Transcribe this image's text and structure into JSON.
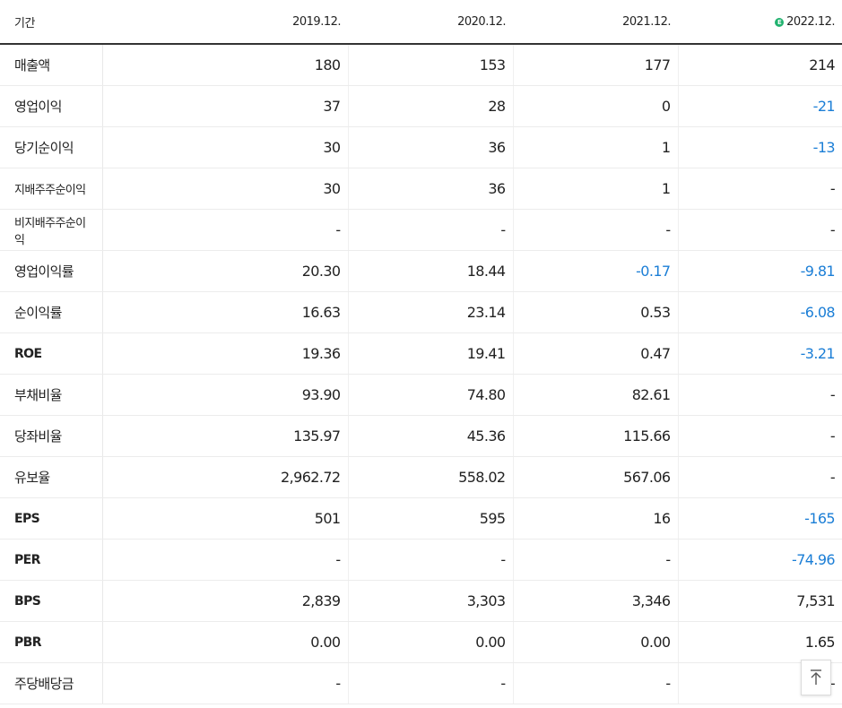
{
  "header": {
    "period_label": "기간",
    "years": [
      "2019.12.",
      "2020.12.",
      "2021.12.",
      "2022.12."
    ],
    "estimate_badge": "E"
  },
  "rows": [
    {
      "label": "매출액",
      "values": [
        "180",
        "153",
        "177",
        "214"
      ]
    },
    {
      "label": "영업이익",
      "values": [
        "37",
        "28",
        "0",
        "-21"
      ]
    },
    {
      "label": "당기순이익",
      "values": [
        "30",
        "36",
        "1",
        "-13"
      ]
    },
    {
      "label": "지배주주순이익",
      "values": [
        "30",
        "36",
        "1",
        "-"
      ]
    },
    {
      "label": "비지배주주순이익",
      "values": [
        "-",
        "-",
        "-",
        "-"
      ]
    },
    {
      "label": "영업이익률",
      "values": [
        "20.30",
        "18.44",
        "-0.17",
        "-9.81"
      ]
    },
    {
      "label": "순이익률",
      "values": [
        "16.63",
        "23.14",
        "0.53",
        "-6.08"
      ]
    },
    {
      "label": "ROE",
      "values": [
        "19.36",
        "19.41",
        "0.47",
        "-3.21"
      ]
    },
    {
      "label": "부채비율",
      "values": [
        "93.90",
        "74.80",
        "82.61",
        "-"
      ]
    },
    {
      "label": "당좌비율",
      "values": [
        "135.97",
        "45.36",
        "115.66",
        "-"
      ]
    },
    {
      "label": "유보율",
      "values": [
        "2,962.72",
        "558.02",
        "567.06",
        "-"
      ]
    },
    {
      "label": "EPS",
      "values": [
        "501",
        "595",
        "16",
        "-165"
      ]
    },
    {
      "label": "PER",
      "values": [
        "-",
        "-",
        "-",
        "-74.96"
      ]
    },
    {
      "label": "BPS",
      "values": [
        "2,839",
        "3,303",
        "3,346",
        "7,531"
      ]
    },
    {
      "label": "PBR",
      "values": [
        "0.00",
        "0.00",
        "0.00",
        "1.65"
      ]
    },
    {
      "label": "주당배당금",
      "values": [
        "-",
        "-",
        "-",
        "-"
      ]
    }
  ],
  "scroll_top_button": {
    "icon": "arrow-up-to-top-icon"
  },
  "colors": {
    "negative": "#1b7ed6",
    "estimate_badge": "#21b26f"
  }
}
